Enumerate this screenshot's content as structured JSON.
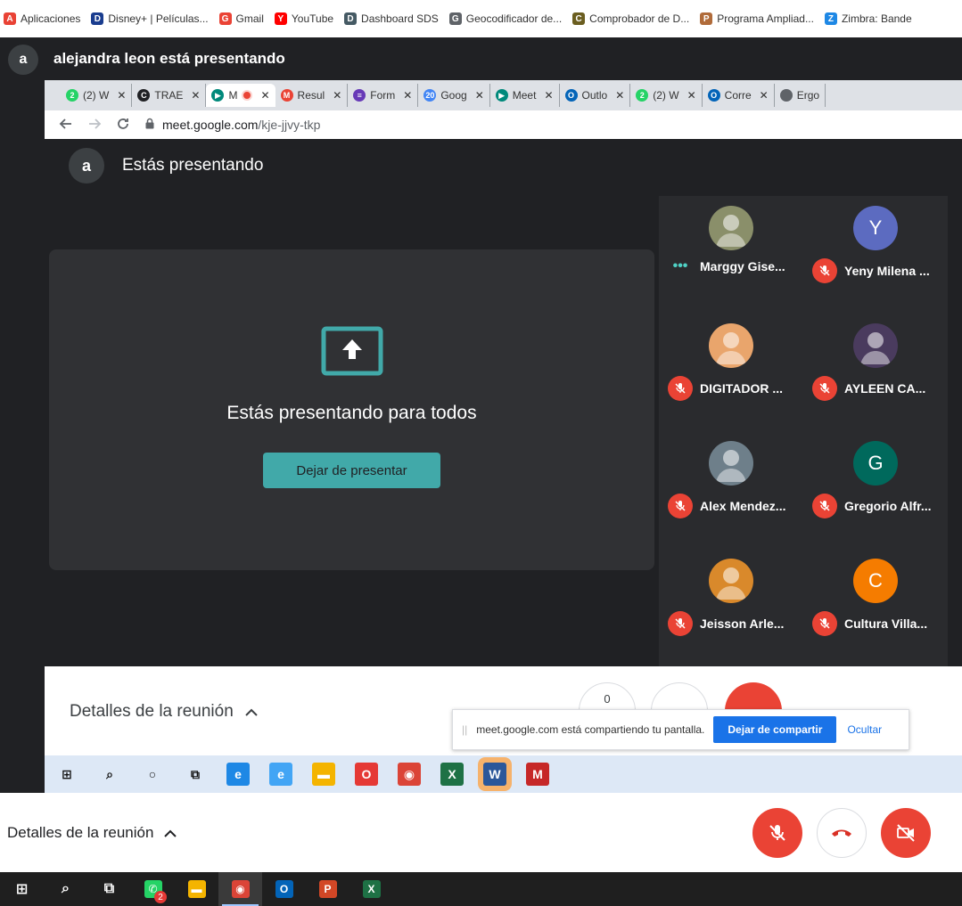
{
  "bookmarks": [
    {
      "label": "Aplicaciones",
      "icon": "apps-grid-icon",
      "color": "#e94235"
    },
    {
      "label": "Disney+ | Películas...",
      "icon": "disney-icon",
      "color": "#1a3d8f"
    },
    {
      "label": "Gmail",
      "icon": "gmail-icon",
      "color": "#ea4335"
    },
    {
      "label": "YouTube",
      "icon": "youtube-icon",
      "color": "#ff0000"
    },
    {
      "label": "Dashboard SDS",
      "icon": "dashboard-icon",
      "color": "#455a64"
    },
    {
      "label": "Geocodificador de...",
      "icon": "globe-icon",
      "color": "#5f6368"
    },
    {
      "label": "Comprobador de D...",
      "icon": "computer-icon",
      "color": "#6b5e20"
    },
    {
      "label": "Programa Ampliad...",
      "icon": "syringe-icon",
      "color": "#b06b3a"
    },
    {
      "label": "Zimbra: Bande",
      "icon": "zimbra-icon",
      "color": "#1e88e5"
    }
  ],
  "outer": {
    "avatar_letter": "a",
    "presenting_title": "alejandra leon está presentando",
    "details_label": "Detalles de la reunión"
  },
  "tabs": [
    {
      "label": "(2) W",
      "icon": "whatsapp-icon",
      "color": "#25d366",
      "glyph": "2"
    },
    {
      "label": "TRAE",
      "icon": "chrome-app-icon",
      "color": "#202124",
      "glyph": "C"
    },
    {
      "label": "M",
      "icon": "meet-icon",
      "color": "#00897b",
      "glyph": "▶",
      "active": true
    },
    {
      "label": "Resul",
      "icon": "gmail-icon",
      "color": "#ea4335",
      "glyph": "M"
    },
    {
      "label": "Form",
      "icon": "forms-icon",
      "color": "#673ab7",
      "glyph": "≡"
    },
    {
      "label": "Goog",
      "icon": "calendar-icon",
      "color": "#4285f4",
      "glyph": "20"
    },
    {
      "label": "Meet",
      "icon": "meet-icon",
      "color": "#00897b",
      "glyph": "▶"
    },
    {
      "label": "Outlo",
      "icon": "outlook-icon",
      "color": "#0364b8",
      "glyph": "O"
    },
    {
      "label": "(2) W",
      "icon": "whatsapp-icon",
      "color": "#25d366",
      "glyph": "2"
    },
    {
      "label": "Corre",
      "icon": "outlook-icon",
      "color": "#0364b8",
      "glyph": "O"
    },
    {
      "label": "Ergo",
      "icon": "globe-icon",
      "color": "#5f6368",
      "glyph": ""
    }
  ],
  "address": {
    "host": "meet.google.com",
    "path": "/kje-jjvy-tkp"
  },
  "inner": {
    "avatar_letter": "a",
    "title": "Estás presentando",
    "present_text": "Estás presentando para todos",
    "stop_label": "Dejar de presentar",
    "details_label": "Detalles de la reunión",
    "ctl_mic_label": "0"
  },
  "participants": [
    {
      "name": "Marggy Gise...",
      "avatar_type": "photo",
      "color": "#8a8f6a",
      "muted": false,
      "speaking": true
    },
    {
      "name": "Yeny Milena ...",
      "avatar_type": "letter",
      "letter": "Y",
      "color": "#5c6bc0",
      "muted": true
    },
    {
      "name": "DIGITADOR ...",
      "avatar_type": "photo",
      "color": "#e9a56c",
      "muted": true
    },
    {
      "name": "AYLEEN CA...",
      "avatar_type": "photo",
      "color": "#4a3b5e",
      "muted": true
    },
    {
      "name": "Alex Mendez...",
      "avatar_type": "photo",
      "color": "#6e7f8a",
      "muted": true
    },
    {
      "name": "Gregorio Alfr...",
      "avatar_type": "letter",
      "letter": "G",
      "color": "#00695c",
      "muted": true
    },
    {
      "name": "Jeisson Arle...",
      "avatar_type": "photo",
      "color": "#d9892b",
      "muted": true
    },
    {
      "name": "Cultura Villa...",
      "avatar_type": "letter",
      "letter": "C",
      "color": "#f57c00",
      "muted": true
    }
  ],
  "share_popup": {
    "message": "meet.google.com está compartiendo tu pantalla.",
    "stop_label": "Dejar de compartir",
    "hide_label": "Ocultar"
  },
  "inner_taskbar": [
    {
      "icon": "windows-start-icon",
      "color": "#111111",
      "glyph": "⊞"
    },
    {
      "icon": "search-icon",
      "color": "#111111",
      "glyph": "⌕"
    },
    {
      "icon": "cortana-icon",
      "color": "#111111",
      "glyph": "○"
    },
    {
      "icon": "task-view-icon",
      "color": "#111111",
      "glyph": "⧉"
    },
    {
      "icon": "edge-icon",
      "color": "#1e88e5",
      "glyph": "e"
    },
    {
      "icon": "internet-explorer-icon",
      "color": "#42a5f5",
      "glyph": "e"
    },
    {
      "icon": "file-explorer-icon",
      "color": "#f4b400",
      "glyph": "▬"
    },
    {
      "icon": "opera-icon",
      "color": "#e53935",
      "glyph": "O"
    },
    {
      "icon": "chrome-icon",
      "color": "#db4437",
      "glyph": "◉"
    },
    {
      "icon": "excel-icon",
      "color": "#1e7145",
      "glyph": "X"
    },
    {
      "icon": "word-icon",
      "color": "#2b579a",
      "glyph": "W",
      "active": true
    },
    {
      "icon": "mcafee-icon",
      "color": "#c62828",
      "glyph": "M"
    }
  ],
  "taskbar": [
    {
      "icon": "windows-start-icon",
      "color": "#ffffff",
      "glyph": "⊞"
    },
    {
      "icon": "search-icon",
      "color": "#ffffff",
      "glyph": "⌕"
    },
    {
      "icon": "task-view-icon",
      "color": "#ffffff",
      "glyph": "⧉"
    },
    {
      "icon": "whatsapp-icon",
      "color": "#25d366",
      "glyph": "✆",
      "badge": "2"
    },
    {
      "icon": "file-explorer-icon",
      "color": "#f4b400",
      "glyph": "▬"
    },
    {
      "icon": "chrome-icon",
      "color": "#db4437",
      "glyph": "◉",
      "active": true
    },
    {
      "icon": "outlook-icon",
      "color": "#0364b8",
      "glyph": "O"
    },
    {
      "icon": "powerpoint-icon",
      "color": "#d24726",
      "glyph": "P"
    },
    {
      "icon": "excel-icon",
      "color": "#1e7145",
      "glyph": "X"
    }
  ],
  "colors": {
    "meet_bg": "#202124",
    "accent_teal": "#41a9a9",
    "danger_red": "#ea4335",
    "link_blue": "#1a73e8"
  }
}
